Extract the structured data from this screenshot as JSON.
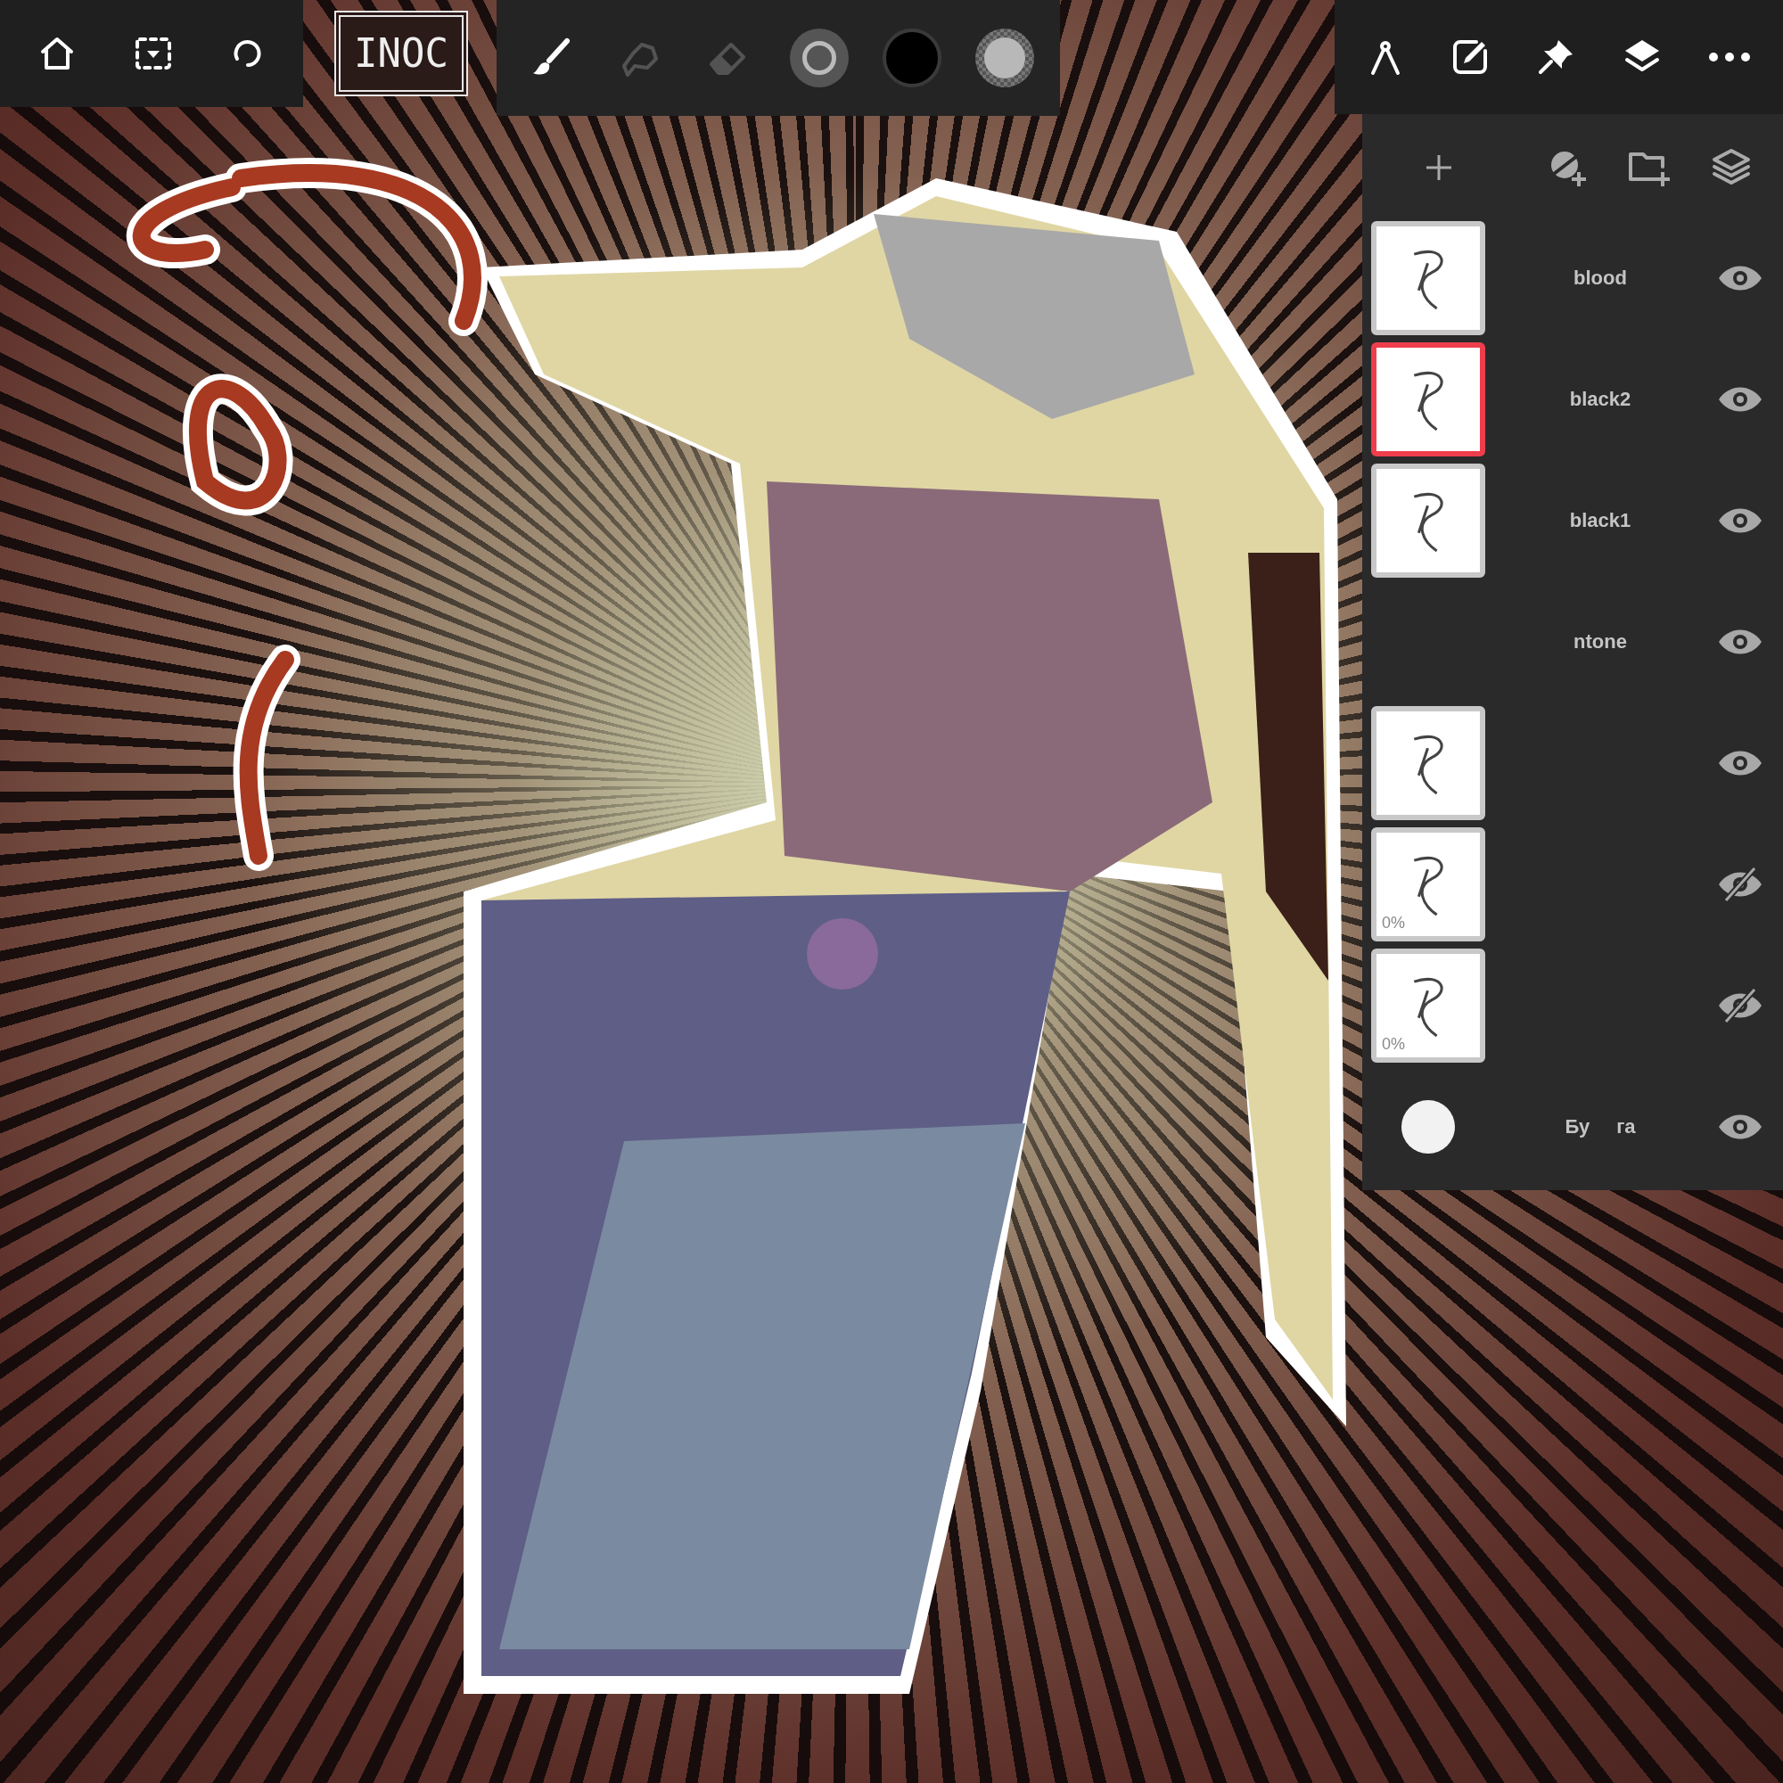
{
  "top_left_tools": [
    {
      "kind": "home"
    },
    {
      "kind": "selection"
    },
    {
      "kind": "lasso"
    }
  ],
  "signature": {
    "text": "INOC"
  },
  "brush_tools": [
    {
      "kind": "brush",
      "selected": true
    },
    {
      "kind": "smudge",
      "selected": false
    },
    {
      "kind": "eraser",
      "selected": false
    }
  ],
  "color_swatch": {
    "color": "#000000"
  },
  "right_tools": [
    {
      "kind": "ruler"
    },
    {
      "kind": "edit"
    },
    {
      "kind": "pin"
    },
    {
      "kind": "layers"
    },
    {
      "kind": "more"
    }
  ],
  "layer_panel": {
    "actions": [
      {
        "kind": "add"
      },
      {
        "kind": "mask"
      },
      {
        "kind": "folder"
      },
      {
        "kind": "stack"
      }
    ],
    "layers": [
      {
        "name": [
          "blood"
        ],
        "kind": "sketch",
        "selected": false,
        "visible": true
      },
      {
        "name": [
          "black2"
        ],
        "kind": "sketch",
        "selected": true,
        "visible": true
      },
      {
        "name": [
          "black1"
        ],
        "kind": "sketch",
        "selected": false,
        "visible": true
      },
      {
        "name": [
          "ntone"
        ],
        "kind": "hidden",
        "selected": false,
        "visible": true
      },
      {
        "kind": "sketch",
        "selected": false,
        "visible": true
      },
      {
        "kind": "sketch",
        "selected": false,
        "visible": false,
        "opacity": "0%"
      },
      {
        "kind": "sketch",
        "selected": false,
        "visible": false,
        "opacity": "0%"
      },
      {
        "name": [
          "Бу",
          "га"
        ],
        "kind": "paper",
        "selected": false,
        "visible": true
      }
    ]
  }
}
